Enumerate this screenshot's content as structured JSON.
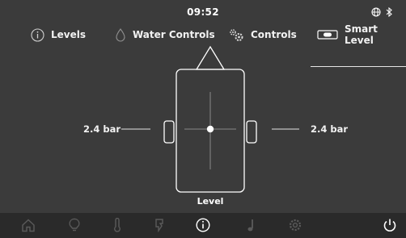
{
  "status": {
    "time": "09:52",
    "globe_icon": "globe-icon",
    "bluetooth_icon": "bluetooth-icon"
  },
  "tabs": [
    {
      "label": "Levels",
      "icon": "info-icon"
    },
    {
      "label": "Water Controls",
      "icon": "water-drop-icon"
    },
    {
      "label": "Controls",
      "icon": "gears-icon"
    },
    {
      "label": "Smart Level",
      "icon": "level-icon",
      "active": true
    }
  ],
  "level": {
    "left_reading": "2.4 bar",
    "right_reading": "2.4 bar",
    "label": "Level"
  },
  "bottom_nav": [
    {
      "icon": "home-icon"
    },
    {
      "icon": "bulb-icon"
    },
    {
      "icon": "thermometer-icon"
    },
    {
      "icon": "power-plug-icon"
    },
    {
      "icon": "info-icon",
      "active": true
    },
    {
      "icon": "music-note-icon"
    },
    {
      "icon": "settings-icon"
    },
    {
      "icon": "power-icon"
    }
  ],
  "colors": {
    "background": "#3b3b3b",
    "nav_background": "#2a2a2a",
    "active": "#ffffff",
    "inactive": "#5a5a5a"
  }
}
